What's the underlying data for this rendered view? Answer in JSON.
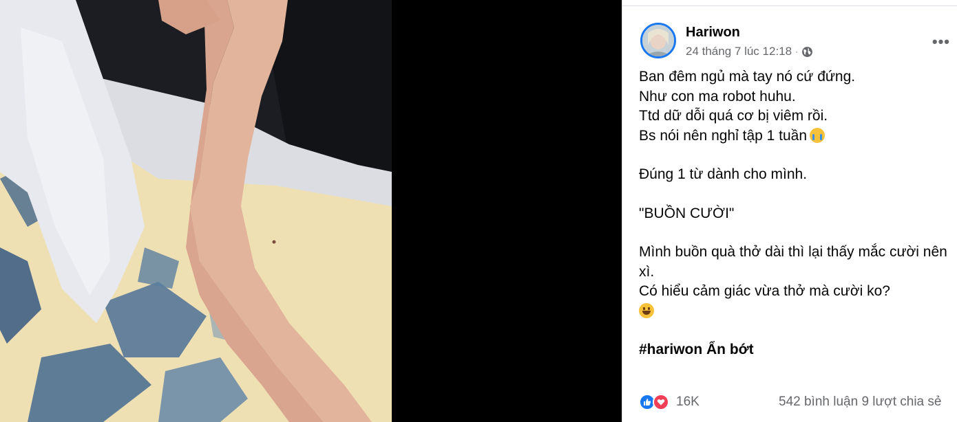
{
  "post": {
    "author": "Hariwon",
    "timestamp": "24 tháng 7 lúc 12:18",
    "separator": "·",
    "privacy_icon": "globe-icon",
    "more_label": "•••",
    "lines": {
      "l1": "Ban đêm ngủ mà tay nó cứ đứng.",
      "l2": "Như con ma robot huhu.",
      "l3": "Ttd dữ dỗi quá cơ bị viêm rồi.",
      "l4": "Bs nói nên nghỉ tập 1 tuần",
      "l5": "Đúng 1 từ dành cho mình.",
      "l6": "\"BUỒN CƯỜI\"",
      "l7": "Mình buồn quà thở dài thì lại thấy mắc cười nên xì.",
      "l8": "Có hiểu cảm giác vừa thở mà cười ko?"
    },
    "hashtag": "#hariwon Ẩn bớt",
    "reactions": {
      "icons": [
        "like-icon",
        "love-icon"
      ],
      "count": "16K"
    },
    "comments": "542 bình luận",
    "shares": "9 lượt chia sẻ",
    "colors": {
      "accent": "#1877f2",
      "love": "#f33e58",
      "secondary_text": "#65676b"
    }
  }
}
